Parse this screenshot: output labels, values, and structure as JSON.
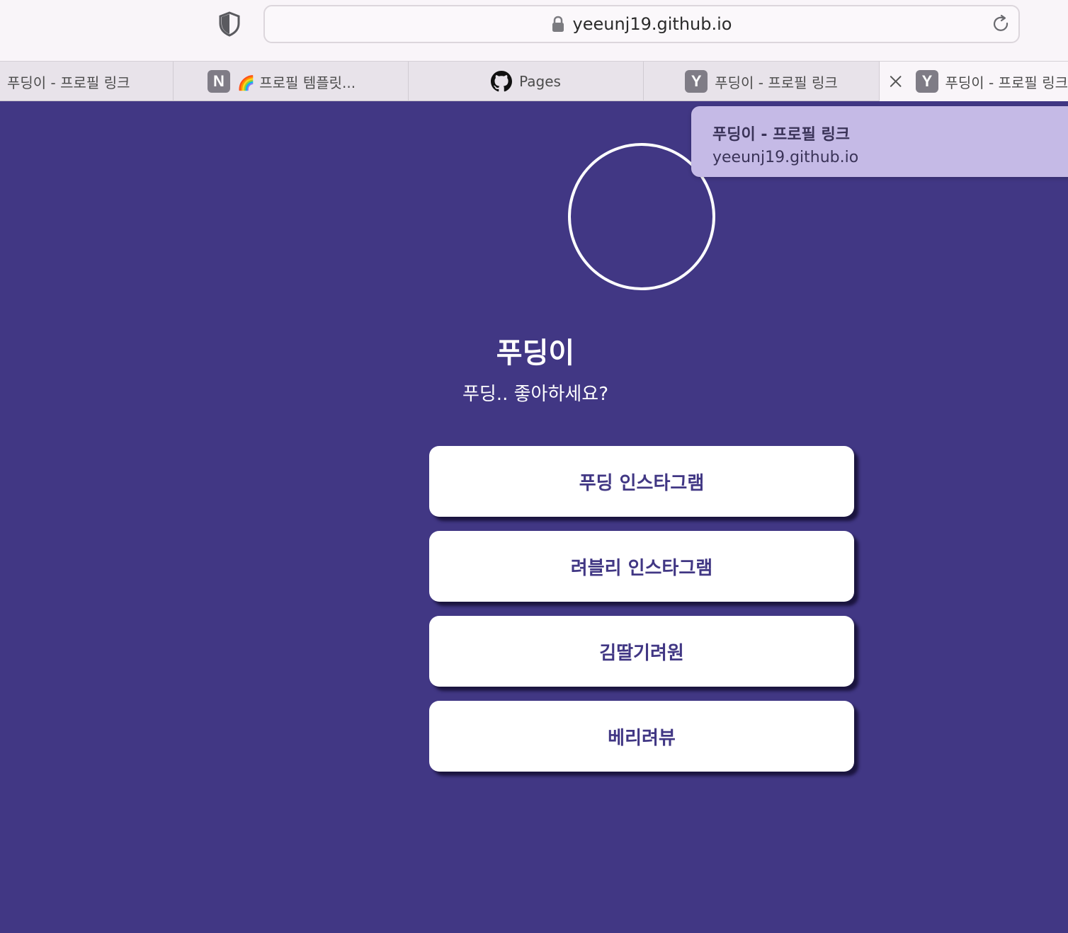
{
  "browser": {
    "url": "yeeunj19.github.io",
    "tabs": [
      {
        "title": "푸딩이 - 프로필 링크"
      },
      {
        "favicon": "N",
        "title": "🌈 프로필 템플릿..."
      },
      {
        "title": "Pages"
      },
      {
        "favicon": "Y",
        "title": "푸딩이 - 프로필 링크"
      },
      {
        "favicon": "Y",
        "title": "푸딩이 - 프로필 링크"
      }
    ],
    "tooltip": {
      "title": "푸딩이 - 프로필 링크",
      "url": "yeeunj19.github.io"
    }
  },
  "profile": {
    "name": "푸딩이",
    "bio": "푸딩.. 좋아하세요?"
  },
  "links": [
    {
      "label": "푸딩 인스타그램"
    },
    {
      "label": "려블리 인스타그램"
    },
    {
      "label": "김딸기려원"
    },
    {
      "label": "베리려뷰"
    }
  ],
  "colors": {
    "background": "#413784",
    "button": "#ffffff",
    "button_text": "#413784",
    "tooltip": "#c5bae6"
  }
}
